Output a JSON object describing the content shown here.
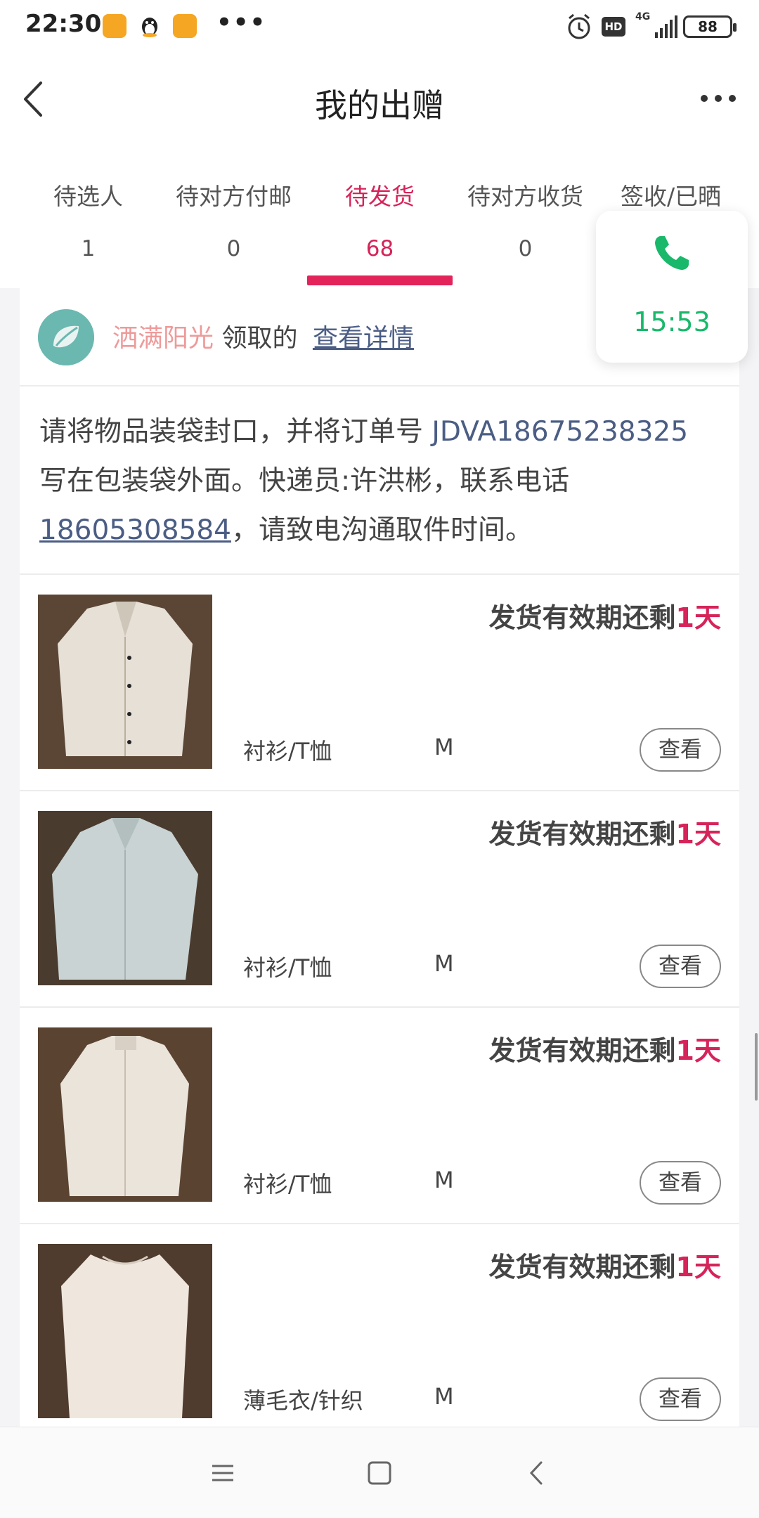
{
  "status_bar": {
    "time": "22:30",
    "dots": "•••",
    "battery": "88",
    "network": "4G",
    "hd": "HD"
  },
  "header": {
    "title": "我的出赠"
  },
  "tabs": [
    {
      "label": "待选人",
      "count": "1"
    },
    {
      "label": "待对方付邮",
      "count": "0"
    },
    {
      "label": "待发货",
      "count": "68",
      "active": true
    },
    {
      "label": "待对方收货",
      "count": "0"
    },
    {
      "label": "签收/已晒",
      "count": ""
    }
  ],
  "call_widget": {
    "timer": "15:53",
    "color": "#19b86b"
  },
  "card": {
    "receiver": "洒满阳光",
    "received_text": "领取的",
    "detail_link": "查看详情",
    "notice_prefix": "请将物品装袋封口，并将订单号 ",
    "order_no": "JDVA18675238325",
    "notice_mid": " 写在包装袋外面。快递员:许洪彬，联系电话",
    "phone": "18605308584",
    "notice_suffix": "，请致电沟通取件时间。"
  },
  "items": [
    {
      "deadline_text": "发货有效期还剩",
      "deadline_days": "1天",
      "category": "衬衫/T恤",
      "size": "M",
      "button": "查看"
    },
    {
      "deadline_text": "发货有效期还剩",
      "deadline_days": "1天",
      "category": "衬衫/T恤",
      "size": "M",
      "button": "查看"
    },
    {
      "deadline_text": "发货有效期还剩",
      "deadline_days": "1天",
      "category": "衬衫/T恤",
      "size": "M",
      "button": "查看"
    },
    {
      "deadline_text": "发货有效期还剩",
      "deadline_days": "1天",
      "category": "薄毛衣/针织",
      "size": "M",
      "button": "查看"
    }
  ],
  "colors": {
    "accent": "#d6245a",
    "link": "#4b5d84",
    "receiver": "#ee9a9a"
  }
}
